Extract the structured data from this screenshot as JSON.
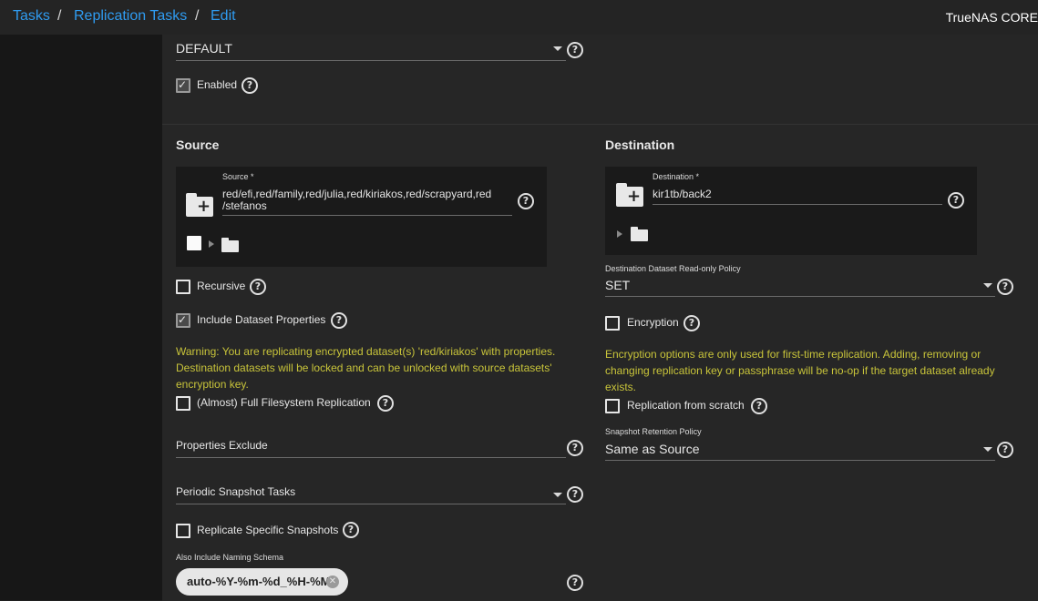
{
  "breadcrumb": {
    "items": [
      "Tasks",
      "Replication Tasks",
      "Edit"
    ],
    "separator": "/"
  },
  "brand": "TrueNAS CORE",
  "top_form": {
    "transport_value": "DEFAULT",
    "enabled_label": "Enabled",
    "enabled_checked": true
  },
  "source": {
    "section_title": "Source",
    "field_label": "Source *",
    "value_line1": "red/efi,red/family,red/julia,red/kiriakos,red/scrapyard,red",
    "value_line2": "/stefanos",
    "recursive_label": "Recursive",
    "recursive_checked": false,
    "include_props_label": "Include Dataset Properties",
    "include_props_checked": true,
    "warning_line1": "Warning: You are replicating encrypted dataset(s) 'red/kiriakos' with properties.",
    "warning_line2": "Destination datasets will be locked and can be unlocked with source datasets'",
    "warning_line3": "encryption key.",
    "full_fs_label": "(Almost) Full Filesystem Replication",
    "full_fs_checked": false,
    "props_exclude_label": "Properties Exclude",
    "periodic_label": "Periodic Snapshot Tasks",
    "replicate_specific_label": "Replicate Specific Snapshots",
    "replicate_specific_checked": false,
    "naming_schema_label": "Also Include Naming Schema",
    "naming_schema_chip": "auto-%Y-%m-%d_%H-%M"
  },
  "destination": {
    "section_title": "Destination",
    "field_label": "Destination *",
    "value": "kir1tb/back2",
    "readonly_policy_label": "Destination Dataset Read-only Policy",
    "readonly_policy_value": "SET",
    "encryption_label": "Encryption",
    "encryption_checked": false,
    "enc_note_line1": "Encryption options are only used for first-time replication. Adding, removing or",
    "enc_note_line2": "changing replication key or passphrase will be no-op if the target dataset already",
    "enc_note_line3": "exists.",
    "from_scratch_label": "Replication from scratch",
    "from_scratch_checked": false,
    "retention_label": "Snapshot Retention Policy",
    "retention_value": "Same as Source"
  },
  "icons": {
    "help": "help-circle-icon",
    "folder_plus": "folder-plus-icon",
    "folder": "folder-icon",
    "expand": "expand-triangle-icon",
    "dropdown": "dropdown-caret-icon",
    "chip_remove": "close-circle-icon"
  },
  "colors": {
    "link": "#2f9bf0",
    "warning": "#c8c43a",
    "background": "#262626"
  }
}
